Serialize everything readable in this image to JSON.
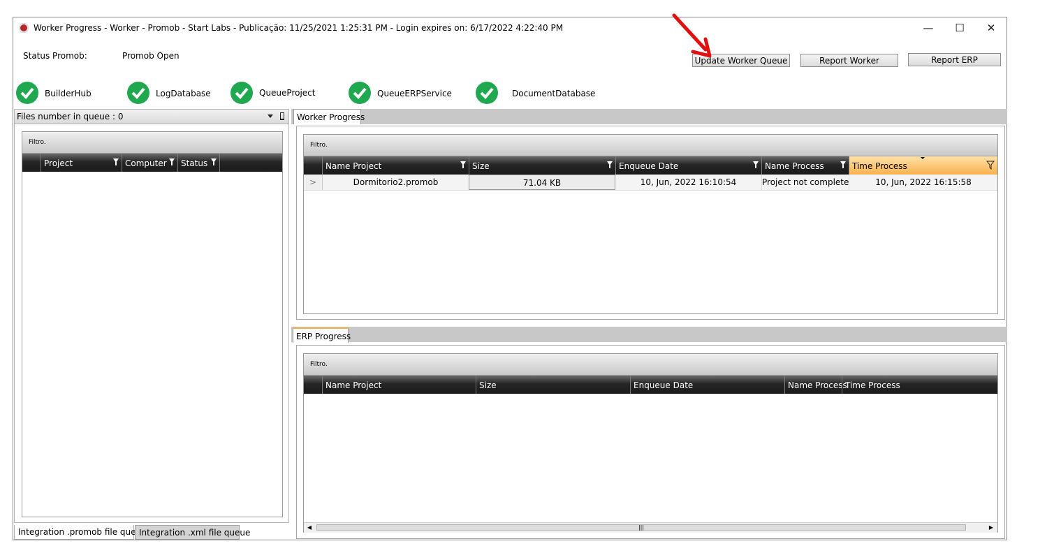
{
  "window": {
    "title": "Worker Progress  -  Worker - Promob  -  Start Labs  -  Publicação: 11/25/2021 1:25:31 PM - Login expires on: 6/17/2022 4:22:40 PM",
    "controls": {
      "minimize": "—",
      "maximize": "☐",
      "close": "✕"
    }
  },
  "status": {
    "label": "Status Promob:",
    "value": "Promob Open"
  },
  "buttons": {
    "update_queue": "Update Worker Queue",
    "report_worker": "Report Worker",
    "report_erp": "Report ERP"
  },
  "services": [
    {
      "name": "BuilderHub",
      "status": "ok"
    },
    {
      "name": "LogDatabase",
      "status": "ok"
    },
    {
      "name": "QueueProject",
      "status": "ok"
    },
    {
      "name": "QueueERPService",
      "status": "ok"
    },
    {
      "name": "DocumentDatabase",
      "status": "ok"
    }
  ],
  "left_panel": {
    "header": "Files number in queue : 0",
    "filter_label": "Filtro.",
    "columns": [
      "Project",
      "Computer",
      "Status"
    ],
    "bottom_tabs": [
      "Integration .promob file queue",
      "Integration .xml file queue"
    ]
  },
  "worker_panel": {
    "tab": "Worker Progress",
    "filter_label": "Filtro.",
    "columns": [
      "Name Project",
      "Size",
      "Enqueue Date",
      "Name Process",
      "Time Process"
    ],
    "rows": [
      {
        "indicator": ">",
        "name_project": "Dormitorio2.promob",
        "size": "71.04 KB",
        "enqueue_date": "10, Jun, 2022 16:10:54",
        "name_process": "Project not completed",
        "time_process": "10, Jun, 2022 16:15:58"
      }
    ]
  },
  "erp_panel": {
    "tab": "ERP Progress",
    "filter_label": "Filtro.",
    "columns": [
      "Name Project",
      "Size",
      "Enqueue Date",
      "Name Process",
      "Time Process"
    ],
    "scroll": {
      "left": "◀",
      "right": "▶",
      "thumb": "|||"
    }
  },
  "colors": {
    "accent_check": "#1fa84f",
    "sorted_column": "#f8b14e",
    "arrow": "#e01010"
  }
}
